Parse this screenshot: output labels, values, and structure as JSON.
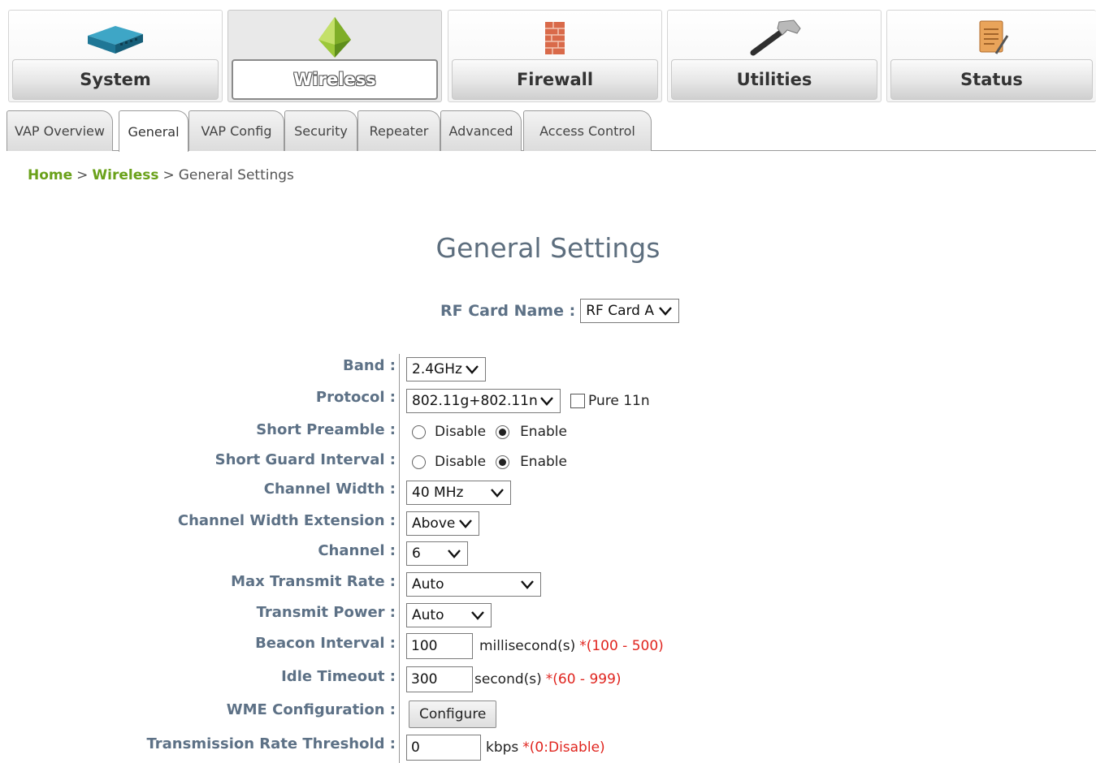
{
  "nav": {
    "items": [
      {
        "label": "System",
        "icon": "router-icon"
      },
      {
        "label": "Wireless",
        "icon": "wireless-pyramid-icon",
        "active": true
      },
      {
        "label": "Firewall",
        "icon": "firewall-icon"
      },
      {
        "label": "Utilities",
        "icon": "hammer-icon"
      },
      {
        "label": "Status",
        "icon": "clipboard-icon"
      }
    ]
  },
  "tabs": [
    {
      "label": "VAP Overview"
    },
    {
      "label": "General",
      "active": true
    },
    {
      "label": "VAP Config"
    },
    {
      "label": "Security"
    },
    {
      "label": "Repeater"
    },
    {
      "label": "Advanced"
    },
    {
      "label": "Access Control"
    }
  ],
  "breadcrumb": {
    "home": "Home",
    "sep": ">",
    "wireless": "Wireless",
    "current": "General Settings"
  },
  "page_title": "General Settings",
  "rf_card": {
    "label": "RF Card Name :",
    "value": "RF Card A"
  },
  "form": {
    "band": {
      "label": "Band :",
      "value": "2.4GHz"
    },
    "protocol": {
      "label": "Protocol :",
      "value": "802.11g+802.11n",
      "pure11n_label": "Pure 11n",
      "pure11n_checked": false
    },
    "short_preamble": {
      "label": "Short Preamble :",
      "option_disable": "Disable",
      "option_enable": "Enable",
      "selected": "Enable"
    },
    "short_guard_interval": {
      "label": "Short Guard Interval :",
      "option_disable": "Disable",
      "option_enable": "Enable",
      "selected": "Enable"
    },
    "channel_width": {
      "label": "Channel Width :",
      "value": "40 MHz"
    },
    "channel_width_extension": {
      "label": "Channel Width Extension :",
      "value": "Above"
    },
    "channel": {
      "label": "Channel :",
      "value": "6"
    },
    "max_transmit_rate": {
      "label": "Max Transmit Rate :",
      "value": "Auto"
    },
    "transmit_power": {
      "label": "Transmit Power :",
      "value": "Auto"
    },
    "beacon_interval": {
      "label": "Beacon Interval :",
      "value": "100",
      "unit": "millisecond(s)",
      "hint": "*(100 - 500)"
    },
    "idle_timeout": {
      "label": "Idle Timeout :",
      "value": "300",
      "unit": "second(s)",
      "hint": "*(60 - 999)"
    },
    "wme_configuration": {
      "label": "WME Configuration :",
      "button": "Configure"
    },
    "transmission_rate_threshold": {
      "label": "Transmission Rate Threshold :",
      "value": "0",
      "unit": "kbps",
      "hint": "*(0:Disable)"
    }
  },
  "colors": {
    "label": "#5d7186",
    "breadcrumb_link": "#6aa11a",
    "hint": "#e0251f",
    "title": "#5d6e7e"
  }
}
